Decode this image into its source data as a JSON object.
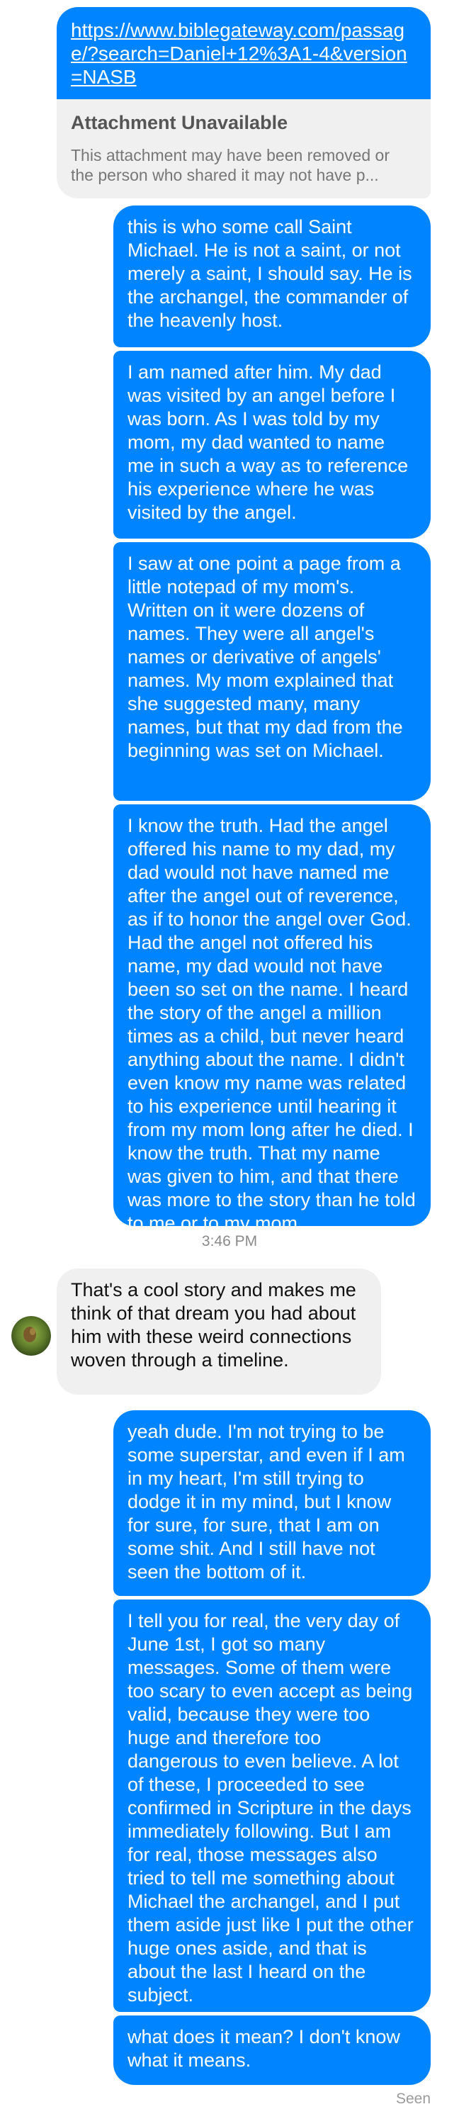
{
  "link_card": {
    "url": "https://www.biblegateway.com/passage/?search=Daniel+12%3A1-4&version=NASB",
    "attachment_title": "Attachment Unavailable",
    "attachment_desc": "This attachment may have been removed or the person who shared it may not have p..."
  },
  "messages_block1": [
    "this is who some call Saint Michael. He is not a saint, or not merely a saint, I should say. He is the archangel, the commander of the heavenly host.",
    "I am named after him. My dad was visited by an angel before I was born. As I was told by my mom, my dad wanted to name me in such a way as to reference his experience where he was visited by the angel.",
    "I saw at one point a page from a little notepad of my mom's. Written on it were dozens of names. They were all angel's names or derivative of angels' names. My mom explained that she suggested many, many names, but that my dad from the beginning was set on Michael.",
    "I know the truth. Had the angel offered his name to my dad, my dad would not have named me after the angel out of reverence, as if to honor the angel over God. Had the angel not offered his name, my dad would not have been so set on the name. I heard the story of the angel a million times as a child, but never heard anything about the name. I didn't even know my name was related to his experience until hearing it from my mom long after he died. I know the truth. That my name was given to him, and that there was more to the story than he told to me or to my mom."
  ],
  "timestamp": "3:46 PM",
  "incoming": {
    "text": "That's a cool story and makes me think of that dream you had about him with these weird connections woven through a timeline."
  },
  "messages_block2": [
    "yeah dude. I'm not trying to be some superstar, and even if I am in my heart, I'm still trying to dodge it in my mind, but I know for sure, for sure, that I am on some shit. And I still have not seen the bottom of it.",
    "I tell you for real, the very day of June 1st, I got so many messages. Some of them were too scary to even accept as being valid, because they were too huge and therefore too dangerous to even believe. A lot of these, I proceeded to see confirmed in Scripture in the days immediately following. But I am for real, those messages also tried to tell me something about Michael the archangel, and I put them aside just like I put the other huge ones aside, and that is about the last I heard on the subject.",
    "what does it mean? I don't know what it means."
  ],
  "seen_label": "Seen",
  "colors": {
    "outgoing_bubble": "#0084ff",
    "incoming_bubble": "#f0f0f0",
    "timestamp_text": "#8a8a8a"
  }
}
